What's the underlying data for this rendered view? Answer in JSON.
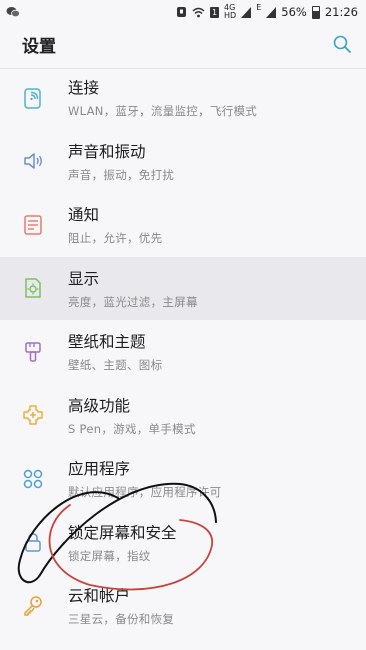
{
  "status_bar": {
    "network_4g": "4G",
    "network_hd": "HD",
    "sim": "1",
    "signal_e": "E",
    "battery": "56%",
    "time": "21:26"
  },
  "header": {
    "title": "设置"
  },
  "settings": [
    {
      "title": "连接",
      "subtitle": "WLAN，蓝牙，流量监控，飞行模式",
      "icon": "wifi-phone-icon",
      "color": "#4fb3c5"
    },
    {
      "title": "声音和振动",
      "subtitle": "声音，振动，免打扰",
      "icon": "speaker-icon",
      "color": "#6a8fd6"
    },
    {
      "title": "通知",
      "subtitle": "阻止，允许，优先",
      "icon": "notification-icon",
      "color": "#e57b6b"
    },
    {
      "title": "显示",
      "subtitle": "亮度，蓝光过滤，主屏幕",
      "icon": "display-icon",
      "color": "#7cbf5f"
    },
    {
      "title": "壁纸和主题",
      "subtitle": "壁纸、主题、图标",
      "icon": "paintbrush-icon",
      "color": "#a06fc4"
    },
    {
      "title": "高级功能",
      "subtitle": "S Pen，游戏，单手模式",
      "icon": "advanced-features-icon",
      "color": "#e8b23a"
    },
    {
      "title": "应用程序",
      "subtitle": "默认应用程序，应用程序许可",
      "icon": "apps-icon",
      "color": "#4f9fd2"
    },
    {
      "title": "锁定屏幕和安全",
      "subtitle": "锁定屏幕，指纹",
      "icon": "lock-icon",
      "color": "#5f9ad0"
    },
    {
      "title": "云和帐户",
      "subtitle": "三星云，备份和恢复",
      "icon": "key-icon",
      "color": "#e6a33c"
    }
  ],
  "annotation_colors": {
    "red": "#c8433a",
    "black": "#111111"
  }
}
